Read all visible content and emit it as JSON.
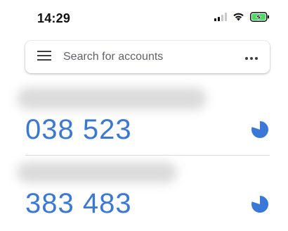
{
  "status_bar": {
    "time": "14:29",
    "icons": [
      "cellular-signal-icon",
      "wifi-icon",
      "battery-charging-icon"
    ]
  },
  "search": {
    "placeholder": "Search for accounts",
    "menu_icon": "hamburger-menu-icon",
    "more_icon": "more-options-icon"
  },
  "accounts": [
    {
      "code": "038 523",
      "timer_icon": "countdown-timer-icon"
    },
    {
      "code": "383 483",
      "timer_icon": "countdown-timer-icon"
    }
  ],
  "colors": {
    "code": "#3a78d8",
    "timer": "#3a78d8",
    "battery_charge": "#4cd964",
    "text_secondary": "#5f6368"
  }
}
